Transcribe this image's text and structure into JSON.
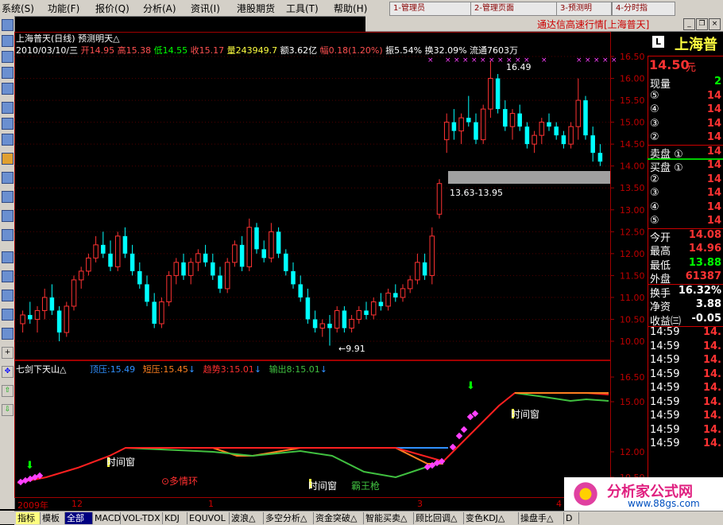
{
  "menu": {
    "items": [
      "系统(S)",
      "功能(F)",
      "报价(Q)",
      "分析(A)",
      "资讯(I)",
      "港股期货",
      "工具(T)",
      "帮助(H)"
    ]
  },
  "window_tabs": [
    "1-管理员",
    "2-管理页面",
    "3-预测明",
    "4-分时指"
  ],
  "brand": {
    "title": "通达信高速行情[上海普天]",
    "stock_name_short": "上海普",
    "price": "14.50",
    "price_unit": "元",
    "l_badge": "L"
  },
  "header": {
    "line1": "上海普天(日线) 预测明天△",
    "date": "2010/03/10/三",
    "open_label": "开",
    "open": "14.95",
    "high_label": "高",
    "high": "15.38",
    "low_label": "低",
    "low": "14.55",
    "close_label": "收",
    "close": "15.17",
    "vol_label": "量",
    "vol": "243949.7",
    "amt_label": "额",
    "amt": "3.62亿",
    "chg_label": "幅",
    "chg": "0.18(1.20%)",
    "amp_label": "振",
    "amp": "5.54%",
    "turn_label": "换",
    "turn": "32.09%",
    "float_label": "流通",
    "float": "7603万"
  },
  "indicator": {
    "name": "七剑下天山△",
    "top_label": "顶压:",
    "top": "15.49",
    "short_label": "短压:",
    "short": "15.45",
    "trend_label": "趋势3:",
    "trend": "15.01",
    "out_label": "输出8:",
    "out": "15.01"
  },
  "annotations": {
    "high_label": "16.49",
    "low_label": "←9.91",
    "zone_label": "13.63-13.95",
    "time_window": "时间窗",
    "multi_ring": "⊙多情环",
    "bawang": "霸王枪"
  },
  "price_axis": [
    "16.50",
    "16.00",
    "15.50",
    "15.00",
    "14.50",
    "14.00",
    "13.50",
    "13.00",
    "12.50",
    "12.00",
    "11.50",
    "11.00",
    "10.50",
    "10.00"
  ],
  "ind_axis": [
    "16.50",
    "15.00",
    "12.00",
    "10.50"
  ],
  "time_axis": [
    "2009年",
    "12",
    "1",
    "3",
    "4"
  ],
  "right_panel": {
    "rows": [
      {
        "label": "现量",
        "val": "2",
        "color": "#0f0"
      },
      {
        "label": "⑤",
        "val": "14",
        "color": "#f33"
      },
      {
        "label": "④",
        "val": "14",
        "color": "#f33"
      },
      {
        "label": "③",
        "val": "14",
        "color": "#f33"
      },
      {
        "label": "②",
        "val": "14",
        "color": "#f33"
      },
      {
        "label": "卖盘 ①",
        "val": "14",
        "color": "#f33"
      },
      {
        "label": "买盘 ①",
        "val": "14",
        "color": "#f33"
      },
      {
        "label": "②",
        "val": "14",
        "color": "#f33"
      },
      {
        "label": "③",
        "val": "14",
        "color": "#f33"
      },
      {
        "label": "④",
        "val": "14",
        "color": "#f33"
      },
      {
        "label": "⑤",
        "val": "14",
        "color": "#f33"
      },
      {
        "label": "今开",
        "val": "14.08",
        "color": "#f33"
      },
      {
        "label": "最高",
        "val": "14.96",
        "color": "#f33"
      },
      {
        "label": "最低",
        "val": "13.88",
        "color": "#0f0"
      },
      {
        "label": "外盘",
        "val": "61387",
        "color": "#f33"
      },
      {
        "label": "换手",
        "val": "16.32%",
        "color": "#fff"
      },
      {
        "label": "净资",
        "val": "3.88",
        "color": "#fff"
      },
      {
        "label": "收益㈢",
        "val": "-0.05",
        "color": "#fff"
      },
      {
        "label": "14:59",
        "val": "14.",
        "color": "#f33"
      },
      {
        "label": "14:59",
        "val": "14.",
        "color": "#f33"
      },
      {
        "label": "14:59",
        "val": "14.",
        "color": "#f33"
      },
      {
        "label": "14:59",
        "val": "14.",
        "color": "#f33"
      },
      {
        "label": "14:59",
        "val": "14.",
        "color": "#f33"
      },
      {
        "label": "14:59",
        "val": "14.",
        "color": "#f33"
      },
      {
        "label": "14:59",
        "val": "14.",
        "color": "#f33"
      },
      {
        "label": "14:59",
        "val": "14.",
        "color": "#f33"
      },
      {
        "label": "14:59",
        "val": "14.",
        "color": "#f33"
      }
    ]
  },
  "bottom_tabs": [
    "指标",
    "模板",
    "全部",
    "MACD",
    "VOL-TDX",
    "KDJ",
    "EQUVOL",
    "波浪△",
    "多空分析△",
    "资金突破△",
    "智能买卖△",
    "顾比回调△",
    "变色KDJ△",
    "操盘手△",
    "D"
  ],
  "logo": {
    "text": "分析家公式网",
    "url": "www.88gs.com"
  },
  "colors": {
    "up": "#ff3232",
    "down": "#00ffff",
    "accent": "#c00000",
    "line_red": "#ff2020",
    "line_orange": "#ff8020",
    "line_green": "#40c040",
    "line_blue": "#3090ff",
    "magenta": "#ff40ff"
  },
  "chart_data": {
    "type": "candlestick",
    "ylim": [
      9.8,
      16.7
    ],
    "candles": [
      [
        10.4,
        10.7,
        10.2,
        10.6
      ],
      [
        10.6,
        10.9,
        10.4,
        10.5
      ],
      [
        10.5,
        10.8,
        10.2,
        10.7
      ],
      [
        10.7,
        11.2,
        10.5,
        11.0
      ],
      [
        11.0,
        11.3,
        10.6,
        10.7
      ],
      [
        10.7,
        10.8,
        10.0,
        10.2
      ],
      [
        10.2,
        10.9,
        10.1,
        10.8
      ],
      [
        10.8,
        11.5,
        10.7,
        11.4
      ],
      [
        11.4,
        11.7,
        11.2,
        11.6
      ],
      [
        11.6,
        12.0,
        11.5,
        11.9
      ],
      [
        11.9,
        12.4,
        11.8,
        12.2
      ],
      [
        12.2,
        12.5,
        11.9,
        12.0
      ],
      [
        12.0,
        12.3,
        11.6,
        11.7
      ],
      [
        11.7,
        12.5,
        11.6,
        12.4
      ],
      [
        12.4,
        12.6,
        11.9,
        12.0
      ],
      [
        12.0,
        12.2,
        11.5,
        11.6
      ],
      [
        11.6,
        11.8,
        11.2,
        11.3
      ],
      [
        11.3,
        11.5,
        10.8,
        10.9
      ],
      [
        10.9,
        11.1,
        10.3,
        10.4
      ],
      [
        10.4,
        11.0,
        10.3,
        10.9
      ],
      [
        10.9,
        11.6,
        10.8,
        11.5
      ],
      [
        11.5,
        11.9,
        11.3,
        11.8
      ],
      [
        11.8,
        12.0,
        11.4,
        11.5
      ],
      [
        11.5,
        11.9,
        11.3,
        11.8
      ],
      [
        11.8,
        12.1,
        11.6,
        12.0
      ],
      [
        12.0,
        12.2,
        11.7,
        11.8
      ],
      [
        11.8,
        12.0,
        11.4,
        11.5
      ],
      [
        11.5,
        11.7,
        11.1,
        11.2
      ],
      [
        11.2,
        11.9,
        11.1,
        11.8
      ],
      [
        11.8,
        12.3,
        11.7,
        12.2
      ],
      [
        12.2,
        12.4,
        11.6,
        11.7
      ],
      [
        11.7,
        12.8,
        11.6,
        12.6
      ],
      [
        12.6,
        12.7,
        12.0,
        12.1
      ],
      [
        12.1,
        12.3,
        11.8,
        11.9
      ],
      [
        11.9,
        12.7,
        11.8,
        12.5
      ],
      [
        12.5,
        12.6,
        11.9,
        12.0
      ],
      [
        12.0,
        12.1,
        11.5,
        11.6
      ],
      [
        11.6,
        11.8,
        11.2,
        11.3
      ],
      [
        11.3,
        11.5,
        10.9,
        11.0
      ],
      [
        11.0,
        11.2,
        10.4,
        10.5
      ],
      [
        10.5,
        10.7,
        10.2,
        10.3
      ],
      [
        10.3,
        10.5,
        10.1,
        10.4
      ],
      [
        10.4,
        10.6,
        9.9,
        10.3
      ],
      [
        10.3,
        10.8,
        10.2,
        10.7
      ],
      [
        10.7,
        10.8,
        10.2,
        10.3
      ],
      [
        10.3,
        10.6,
        10.2,
        10.5
      ],
      [
        10.5,
        10.8,
        10.4,
        10.7
      ],
      [
        10.7,
        10.9,
        10.5,
        10.6
      ],
      [
        10.6,
        11.0,
        10.5,
        10.9
      ],
      [
        10.9,
        11.1,
        10.7,
        10.8
      ],
      [
        10.8,
        11.2,
        10.7,
        11.1
      ],
      [
        11.1,
        11.3,
        10.9,
        11.0
      ],
      [
        11.0,
        11.3,
        10.9,
        11.2
      ],
      [
        11.2,
        11.5,
        11.1,
        11.4
      ],
      [
        11.4,
        12.0,
        11.3,
        11.8
      ],
      [
        11.8,
        12.0,
        11.4,
        11.5
      ],
      [
        11.5,
        12.6,
        11.3,
        12.4
      ],
      [
        12.9,
        13.7,
        12.8,
        13.6
      ],
      [
        14.6,
        15.2,
        14.3,
        15.0
      ],
      [
        15.0,
        15.3,
        14.6,
        14.8
      ],
      [
        14.8,
        15.2,
        14.5,
        15.1
      ],
      [
        15.1,
        15.6,
        14.9,
        15.0
      ],
      [
        15.0,
        15.2,
        14.5,
        14.6
      ],
      [
        14.6,
        15.4,
        14.5,
        15.3
      ],
      [
        15.3,
        16.4,
        15.1,
        16.0
      ],
      [
        16.0,
        16.1,
        15.2,
        15.3
      ],
      [
        15.3,
        15.5,
        14.8,
        14.9
      ],
      [
        14.9,
        15.3,
        14.6,
        15.2
      ],
      [
        15.2,
        15.4,
        14.8,
        14.9
      ],
      [
        14.9,
        15.0,
        14.4,
        14.5
      ],
      [
        14.5,
        14.8,
        14.3,
        14.7
      ],
      [
        14.7,
        15.1,
        14.5,
        15.0
      ],
      [
        15.0,
        15.2,
        14.8,
        14.9
      ],
      [
        14.9,
        15.0,
        14.6,
        14.7
      ],
      [
        14.7,
        14.8,
        14.4,
        14.5
      ],
      [
        14.5,
        15.0,
        14.4,
        14.9
      ],
      [
        14.9,
        16.0,
        14.6,
        15.5
      ],
      [
        15.5,
        15.6,
        14.6,
        14.7
      ],
      [
        14.7,
        14.9,
        14.1,
        14.3
      ],
      [
        14.3,
        14.5,
        14.0,
        14.1
      ]
    ],
    "x": [
      "2009年",
      "12",
      "1",
      "3",
      "4"
    ]
  }
}
